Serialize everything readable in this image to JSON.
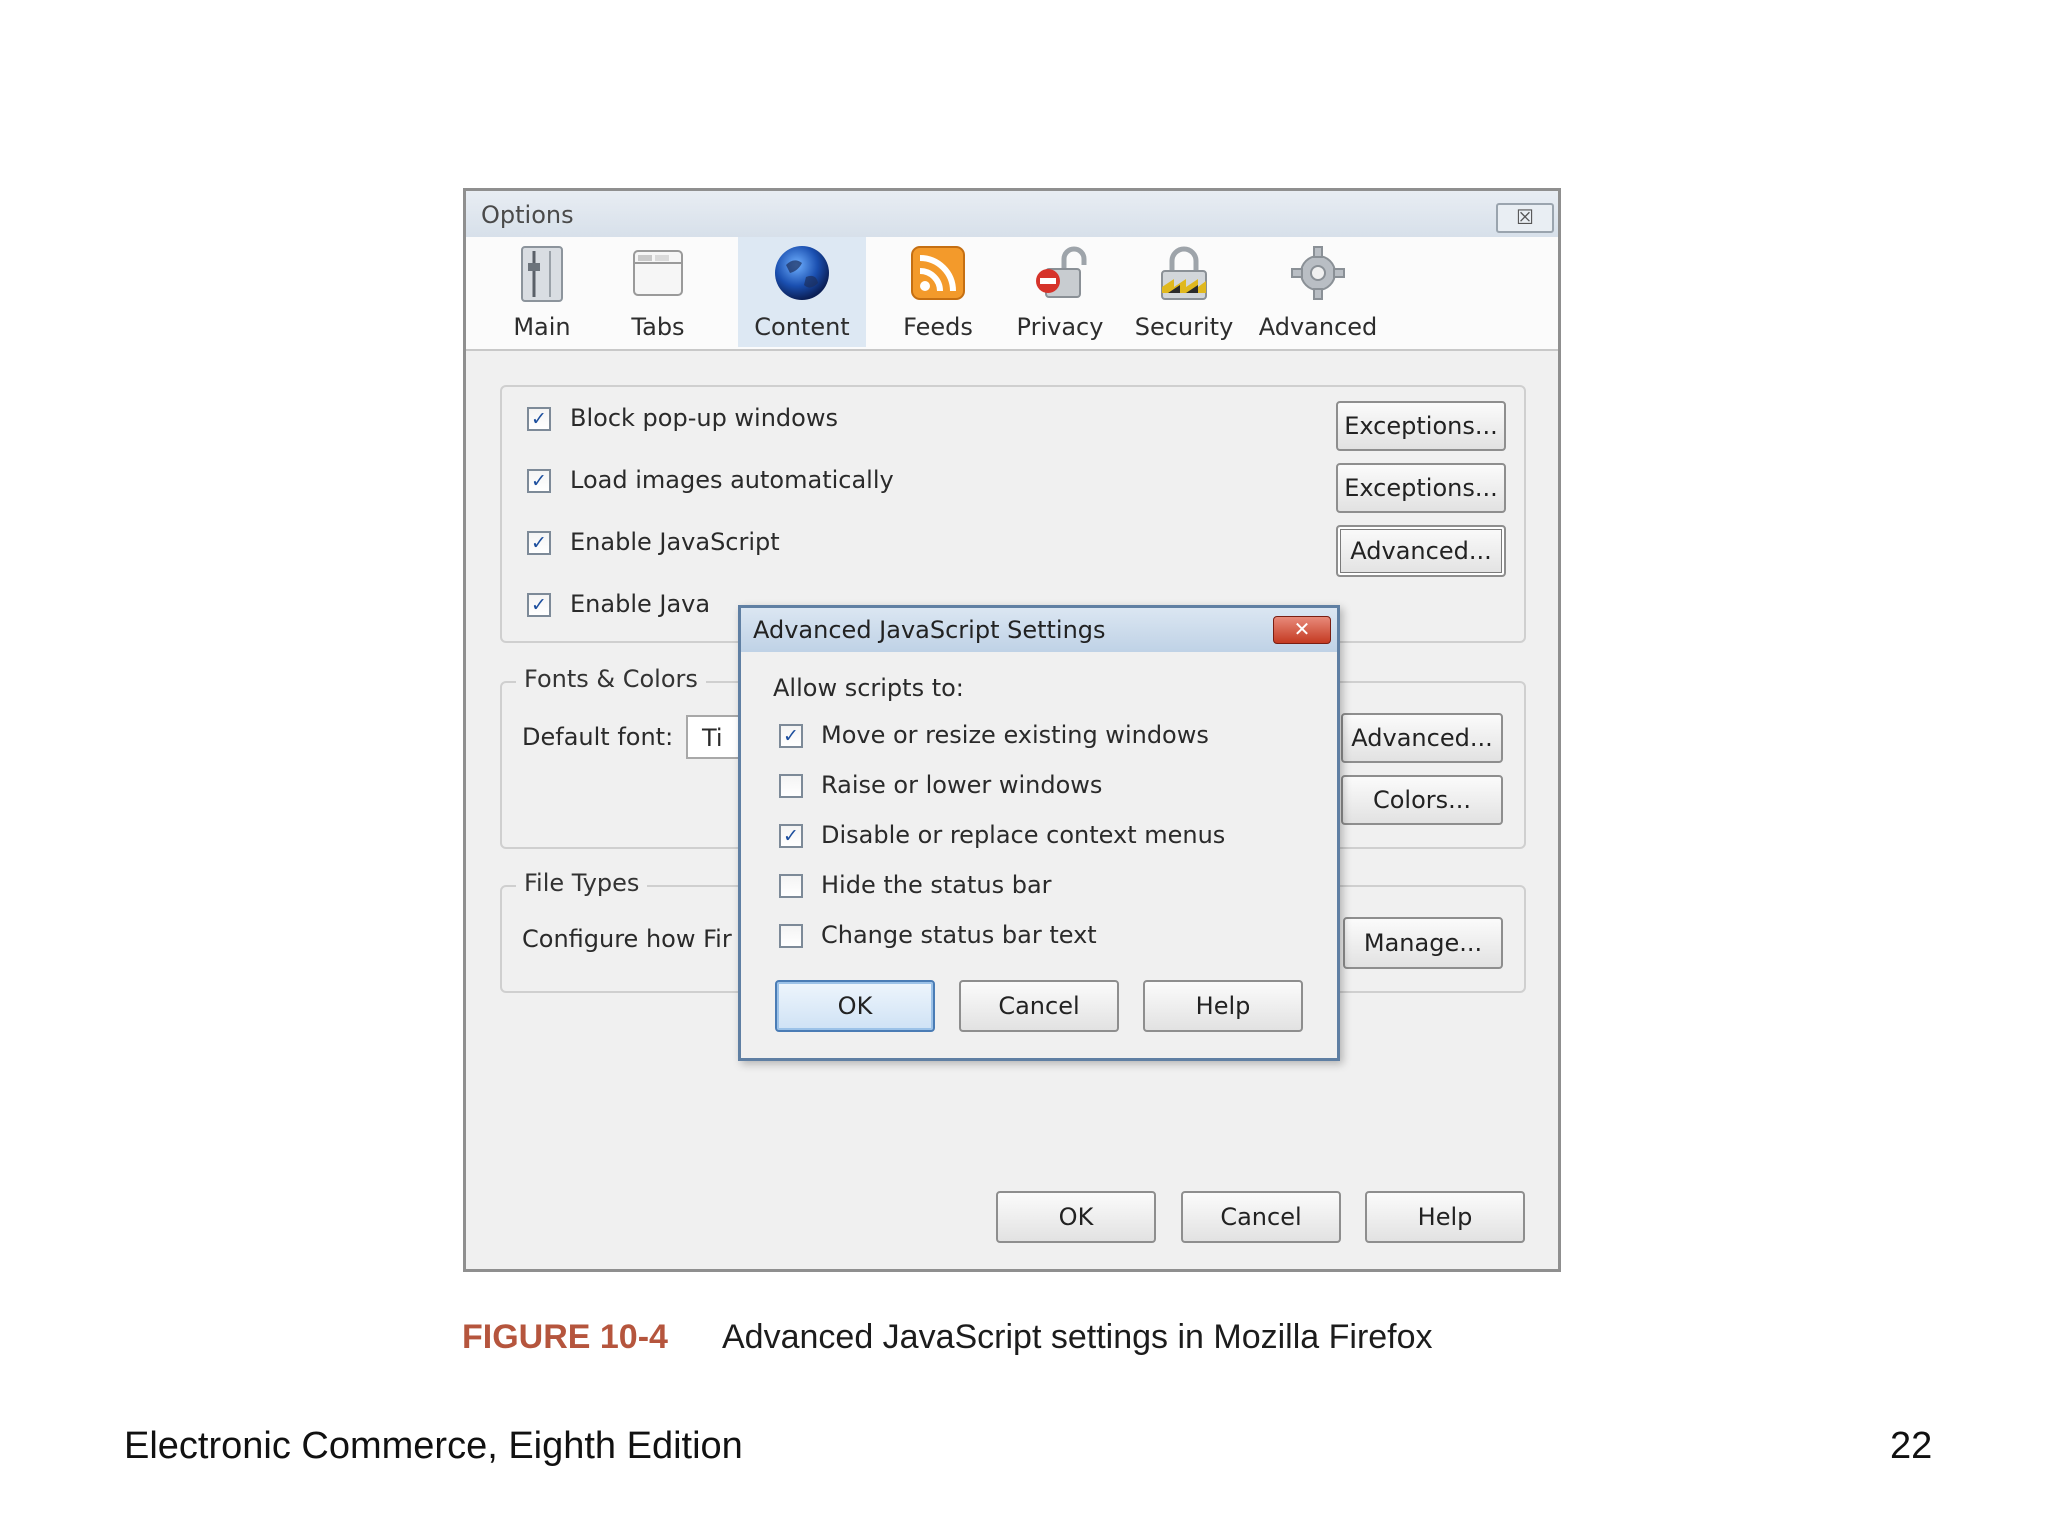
{
  "options_window": {
    "title": "Options",
    "close_glyph": "☒",
    "tabs": [
      {
        "label": "Main",
        "icon": "sliders-icon"
      },
      {
        "label": "Tabs",
        "icon": "tabs-icon"
      },
      {
        "label": "Content",
        "icon": "globe-icon",
        "active": true
      },
      {
        "label": "Feeds",
        "icon": "rss-icon"
      },
      {
        "label": "Privacy",
        "icon": "privacy-lock-icon"
      },
      {
        "label": "Security",
        "icon": "security-padlock-icon"
      },
      {
        "label": "Advanced",
        "icon": "gear-icon"
      }
    ],
    "content_group": {
      "items": [
        {
          "label": "Block pop-up windows",
          "checked": true,
          "button": "Exceptions..."
        },
        {
          "label": "Load images automatically",
          "checked": true,
          "button": "Exceptions..."
        },
        {
          "label": "Enable JavaScript",
          "checked": true,
          "button": "Advanced..."
        },
        {
          "label": "Enable Java",
          "checked": true
        }
      ]
    },
    "fonts_colors": {
      "legend": "Fonts & Colors",
      "default_font_label": "Default font:",
      "default_font_value": "Ti",
      "advanced_button": "Advanced...",
      "colors_button": "Colors..."
    },
    "file_types": {
      "legend": "File Types",
      "description": "Configure how Fir",
      "manage_button": "Manage..."
    },
    "footer_buttons": {
      "ok": "OK",
      "cancel": "Cancel",
      "help": "Help"
    }
  },
  "js_dialog": {
    "title": "Advanced JavaScript Settings",
    "close_glyph": "✕",
    "allow_label": "Allow scripts to:",
    "options": [
      {
        "label": "Move or resize existing windows",
        "checked": true
      },
      {
        "label": "Raise or lower windows",
        "checked": false
      },
      {
        "label": "Disable or replace context menus",
        "checked": true
      },
      {
        "label": "Hide the status bar",
        "checked": false
      },
      {
        "label": "Change status bar text",
        "checked": false
      }
    ],
    "buttons": {
      "ok": "OK",
      "cancel": "Cancel",
      "help": "Help"
    }
  },
  "caption": {
    "figure": "FIGURE 10-4",
    "text": "Advanced JavaScript settings in Mozilla Firefox"
  },
  "footer": {
    "book": "Electronic Commerce, Eighth Edition",
    "page": "22"
  },
  "colors": {
    "caption_accent": "#b5553d",
    "active_tab": "#dde8f3",
    "dialog_border": "#5f7fa3"
  }
}
